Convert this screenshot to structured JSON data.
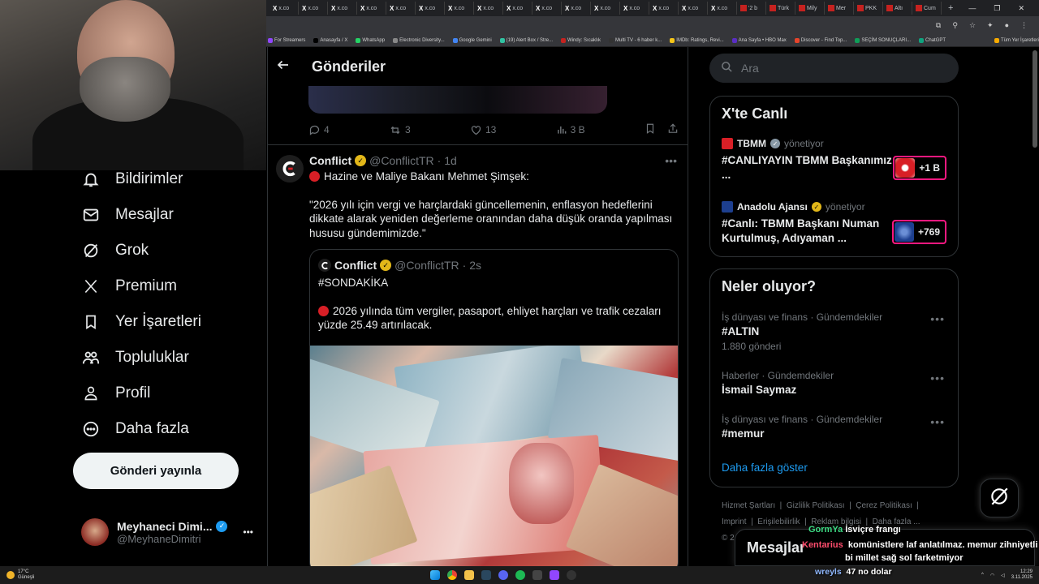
{
  "browser": {
    "tabs": [
      {
        "label": "x.co",
        "red": false
      },
      {
        "label": "x.co",
        "red": false
      },
      {
        "label": "x.co",
        "red": false
      },
      {
        "label": "x.co",
        "red": false
      },
      {
        "label": "x.co",
        "red": false
      },
      {
        "label": "x.co",
        "red": false
      },
      {
        "label": "x.co",
        "red": false
      },
      {
        "label": "x.co",
        "red": false
      },
      {
        "label": "x.co",
        "red": false
      },
      {
        "label": "x.co",
        "red": false
      },
      {
        "label": "x.co",
        "red": false
      },
      {
        "label": "x.co",
        "red": false
      },
      {
        "label": "x.co",
        "red": false
      },
      {
        "label": "x.co",
        "red": false
      },
      {
        "label": "x.co",
        "red": false
      },
      {
        "label": "x.co",
        "red": false
      },
      {
        "label": "'2 b",
        "red": true
      },
      {
        "label": "Türk",
        "red": true
      },
      {
        "label": "Mily",
        "red": true
      },
      {
        "label": "Mer",
        "red": true
      },
      {
        "label": "PKK",
        "red": true
      },
      {
        "label": "Altı",
        "red": true
      },
      {
        "label": "Cum",
        "red": true
      }
    ],
    "new_tab": "+",
    "bookmarks": [
      {
        "label": "For Streamers",
        "color": "#9146ff"
      },
      {
        "label": "Anasayfa / X",
        "color": "#000000"
      },
      {
        "label": "WhatsApp",
        "color": "#25d366"
      },
      {
        "label": "Electronic Diversity...",
        "color": "#888888"
      },
      {
        "label": "Google Gemini",
        "color": "#4285f4"
      },
      {
        "label": "(19) Alert Box / Stre...",
        "color": "#31c3a2"
      },
      {
        "label": "Windy: Sıcaklık",
        "color": "#c5221f"
      },
      {
        "label": "Multi TV - 6 haber k...",
        "color": "#333333"
      },
      {
        "label": "IMDb: Ratings, Revi...",
        "color": "#f5c518"
      },
      {
        "label": "Ana Sayfa • HBO Max",
        "color": "#5a2ec4"
      },
      {
        "label": "Discover - Find Top...",
        "color": "#e6442b"
      },
      {
        "label": "SEÇİM SONUÇLARI...",
        "color": "#0f9d58"
      },
      {
        "label": "ChatGPT",
        "color": "#10a37f"
      },
      {
        "label": "Tüm Yer İşaretleri",
        "color": "#f9ab00"
      }
    ]
  },
  "nav": {
    "items": [
      {
        "label": "Bildirimler",
        "icon": "bell-icon"
      },
      {
        "label": "Mesajlar",
        "icon": "envelope-icon"
      },
      {
        "label": "Grok",
        "icon": "grok-icon"
      },
      {
        "label": "Premium",
        "icon": "x-logo-icon"
      },
      {
        "label": "Yer İşaretleri",
        "icon": "bookmark-icon"
      },
      {
        "label": "Topluluklar",
        "icon": "people-icon"
      },
      {
        "label": "Profil",
        "icon": "person-icon"
      },
      {
        "label": "Daha fazla",
        "icon": "more-circle-icon"
      }
    ],
    "post_button": "Gönderi yayınla",
    "account": {
      "name": "Meyhaneci Dimi...",
      "handle": "@MeyhaneDimitri",
      "menu": "•••"
    }
  },
  "main": {
    "title": "Gönderiler",
    "prev_tweet_actions": {
      "replies": "4",
      "reposts": "3",
      "likes": "13",
      "views": "3 B"
    },
    "tweet": {
      "name": "Conflict",
      "handle": "@ConflictTR",
      "time": "· 1d",
      "menu": "•••",
      "line1": "Hazine ve Maliye Bakanı Mehmet Şimşek:",
      "body": "\"2026 yılı için vergi ve harçlardaki güncellemenin, enflasyon hedeflerini dikkate alarak yeniden değerleme oranından daha düşük oranda yapılması hususu gündemimizde.\"",
      "quote": {
        "name": "Conflict",
        "handle": "@ConflictTR",
        "time": "· 2s",
        "tag": "#SONDAKİKA",
        "body": "2026 yılında tüm vergiler, pasaport, ehliyet harçları ve trafik cezaları yüzde 25.49 artırılacak."
      }
    }
  },
  "right": {
    "search_placeholder": "Ara",
    "live": {
      "title": "X'te Canlı",
      "items": [
        {
          "host": "TBMM",
          "role": "yönetiyor",
          "title": "#CANLIYAYIN TBMM Başkanımız ...",
          "badge": "+1 B",
          "color": "#d81f26"
        },
        {
          "host": "Anadolu Ajansı",
          "role": "yönetiyor",
          "title": "#Canlı: TBMM Başkanı Numan Kurtulmuş, Adıyaman ...",
          "badge": "+769",
          "color": "#1d3f8f"
        }
      ]
    },
    "trends": {
      "title": "Neler oluyor?",
      "items": [
        {
          "meta": "İş dünyası ve finans · Gündemdekiler",
          "name": "#ALTIN",
          "count": "1.880 gönderi"
        },
        {
          "meta": "Haberler · Gündemdekiler",
          "name": "İsmail Saymaz",
          "count": ""
        },
        {
          "meta": "İş dünyası ve finans · Gündemdekiler",
          "name": "#memur",
          "count": ""
        }
      ],
      "more": "Daha fazla göster"
    },
    "footer": {
      "l1": "Hizmet Şartları",
      "l2": "Gizlilik Politikası",
      "l3": "Çerez Politikası",
      "l4": "Imprint",
      "l5": "Erişilebilirlik",
      "l6": "Reklam bilgisi",
      "l7": "Daha fazla ...",
      "copy": "© 2"
    },
    "messages_drawer": "Mesajlar"
  },
  "overlay_chat": [
    {
      "user": "GormYa",
      "text": "İsviçre frangı"
    },
    {
      "user": "Kentarius",
      "text": "komünistlere laf anlatılmaz. memur zihniyetli"
    },
    {
      "user": "",
      "text": "bi millet sağ sol farketmiyor"
    },
    {
      "user": "wreyls",
      "text": "47 no dolar"
    }
  ],
  "taskbar": {
    "weather_temp": "17°C",
    "weather_desc": "Güneşli",
    "time": "12:29",
    "date": "3.11.2025"
  }
}
